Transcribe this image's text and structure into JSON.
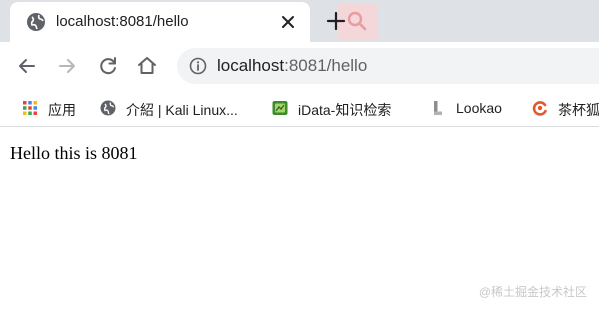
{
  "tab": {
    "title": "localhost:8081/hello",
    "favicon": "globe-icon"
  },
  "toolbar": {
    "back_icon": "arrow-left-icon",
    "forward_icon": "arrow-right-icon",
    "reload_icon": "reload-icon",
    "home_icon": "home-icon"
  },
  "omnibox": {
    "host": "localhost",
    "rest": ":8081/hello",
    "info_icon": "info-icon"
  },
  "bookmarks": [
    {
      "label": "应用",
      "icon": "apps-grid-icon"
    },
    {
      "label": "介紹 | Kali Linux...",
      "icon": "globe-icon"
    },
    {
      "label": "iData-知识检索",
      "icon": "idata-icon"
    },
    {
      "label": "Lookao",
      "icon": "lookao-icon"
    },
    {
      "label": "茶杯狐",
      "icon": "chabeihu-icon"
    }
  ],
  "page": {
    "text": "Hello this is 8081"
  },
  "watermark": {
    "text": "@稀土掘金技术社区"
  },
  "colors": {
    "tabstrip_bg": "#dee1e6",
    "omnibox_bg": "#f1f3f4",
    "ext_badge_bg": "#f4d7d9"
  }
}
